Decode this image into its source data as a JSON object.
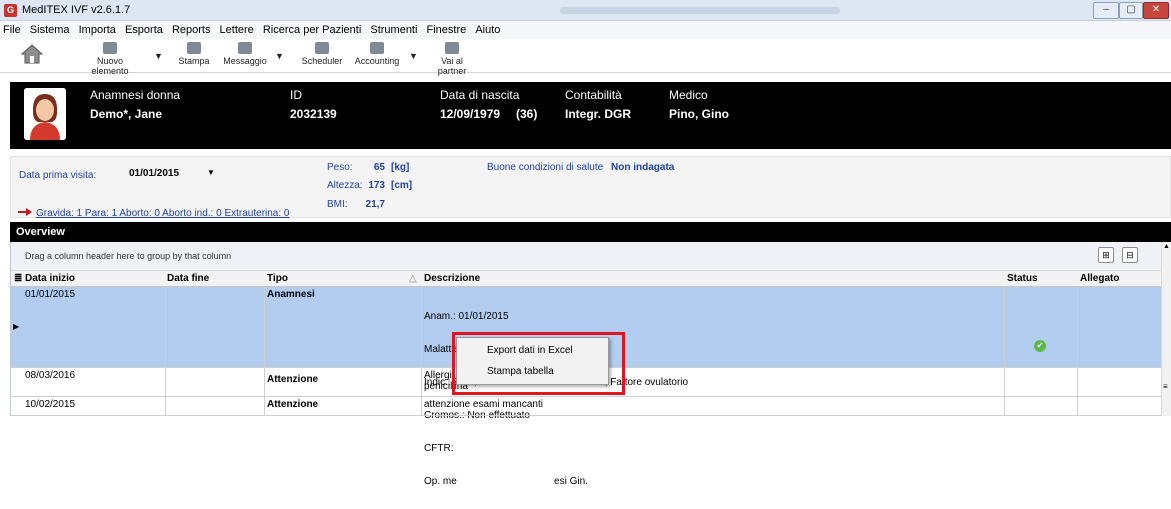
{
  "window": {
    "title": "MedITEX IVF v2.6.1.7",
    "app_icon_letter": "G"
  },
  "menu": [
    "File",
    "Sistema",
    "Importa",
    "Esporta",
    "Reports",
    "Lettere",
    "Ricerca per Pazienti",
    "Strumenti",
    "Finestre",
    "Aiuto"
  ],
  "toolbar": {
    "new_item": "Nuovo elemento",
    "print": "Stampa",
    "message": "Messaggio",
    "scheduler": "Scheduler",
    "accounting": "Accounting",
    "go_partner": "Vai al partner"
  },
  "patient": {
    "type_label": "Anamnesi donna",
    "name": "Demo*, Jane",
    "id_label": "ID",
    "id": "2032139",
    "dob_label": "Data di nascita",
    "dob": "12/09/1979",
    "age": "(36)",
    "accounting_label": "Contabilità",
    "accounting": "Integr. DGR",
    "doctor_label": "Medico",
    "doctor": "Pino, Gino"
  },
  "info": {
    "first_visit_label": "Data prima visita:",
    "first_visit": "01/01/2015",
    "weight_label": "Peso:",
    "weight": "65",
    "weight_unit": "[kg]",
    "height_label": "Altezza:",
    "height": "173",
    "height_unit": "[cm]",
    "bmi_label": "BMI:",
    "bmi": "21,7",
    "health_label": "Buone condizioni di salute",
    "health_value": "Non indagata",
    "obstetric": "Gravida: 1  Para: 1  Aborto: 0  Aborto ind.: 0  Extrauterina: 0"
  },
  "overview": {
    "title": "Overview",
    "group_hint": "Drag a column header here to group by that column",
    "columns": [
      "Data inizio",
      "Data fine",
      "Tipo",
      "Descrizione",
      "Status",
      "Allegato"
    ],
    "rows": [
      {
        "start": "01/01/2015",
        "end": "",
        "type": "Anamnesi",
        "desc": [
          "Anam.: 01/01/2015",
          "Malattie Prec.: Nessuna",
          "Indic.: ETA', Fattore tubarico-aderenziale, Fattore ovulatorio",
          "Cromos.: Non effettuato",
          "CFTR: ",
          "Op. me                                   esi Gin."
        ]
      },
      {
        "start": "08/03/2016",
        "end": "",
        "type": "Attenzione",
        "desc": [
          "Allergi",
          "penicillina"
        ]
      },
      {
        "start": "10/02/2015",
        "end": "",
        "type": "Attenzione",
        "desc": [
          "attenzione esami mancanti"
        ]
      }
    ]
  },
  "context_menu": {
    "items": [
      "Export dati in Excel",
      "Stampa tabella"
    ]
  },
  "colors": {
    "highlight": "#e0151f",
    "selected_row": "#b2cdf0",
    "header_bg": "#000000"
  }
}
